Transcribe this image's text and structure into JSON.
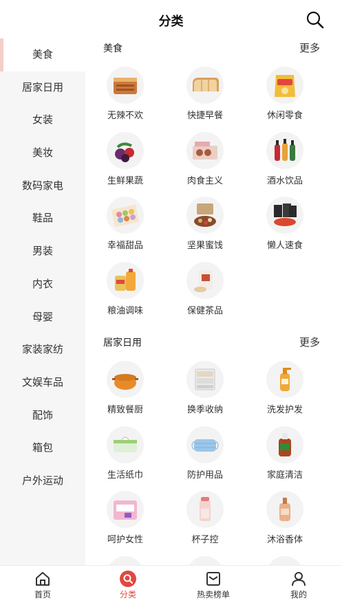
{
  "header": {
    "title": "分类"
  },
  "sidebar": {
    "items": [
      {
        "label": "美食"
      },
      {
        "label": "居家日用"
      },
      {
        "label": "女装"
      },
      {
        "label": "美妆"
      },
      {
        "label": "数码家电"
      },
      {
        "label": "鞋品"
      },
      {
        "label": "男装"
      },
      {
        "label": "内衣"
      },
      {
        "label": "母婴"
      },
      {
        "label": "家装家纺"
      },
      {
        "label": "文娱车品"
      },
      {
        "label": "配饰"
      },
      {
        "label": "箱包"
      },
      {
        "label": "户外运动"
      }
    ],
    "active_index": 0
  },
  "sections": [
    {
      "title": "美食",
      "more": "更多",
      "items": [
        {
          "label": "无辣不欢",
          "icon": "spicy-snack-icon"
        },
        {
          "label": "快捷早餐",
          "icon": "bread-icon"
        },
        {
          "label": "休闲零食",
          "icon": "chips-bag-icon"
        },
        {
          "label": "生鲜果蔬",
          "icon": "fruit-icon"
        },
        {
          "label": "肉食主义",
          "icon": "meat-box-icon"
        },
        {
          "label": "酒水饮品",
          "icon": "bottles-icon"
        },
        {
          "label": "幸福甜品",
          "icon": "macaron-icon"
        },
        {
          "label": "坚果蜜饯",
          "icon": "nuts-icon"
        },
        {
          "label": "懒人速食",
          "icon": "instant-food-icon"
        },
        {
          "label": "粮油调味",
          "icon": "oil-rice-icon"
        },
        {
          "label": "保健茶品",
          "icon": "tea-icon"
        }
      ]
    },
    {
      "title": "居家日用",
      "more": "更多",
      "items": [
        {
          "label": "精致餐厨",
          "icon": "pot-icon"
        },
        {
          "label": "换季收纳",
          "icon": "storage-drawer-icon"
        },
        {
          "label": "洗发护发",
          "icon": "shampoo-icon"
        },
        {
          "label": "生活纸巾",
          "icon": "tissue-icon"
        },
        {
          "label": "防护用品",
          "icon": "mask-icon"
        },
        {
          "label": "家庭清洁",
          "icon": "cleaner-bottle-icon"
        },
        {
          "label": "呵护女性",
          "icon": "sanitary-pad-icon"
        },
        {
          "label": "杯子控",
          "icon": "cup-icon"
        },
        {
          "label": "沐浴香体",
          "icon": "body-wash-icon"
        }
      ]
    }
  ],
  "tabbar": {
    "items": [
      {
        "label": "首页",
        "icon": "home-icon"
      },
      {
        "label": "分类",
        "icon": "category-search-icon"
      },
      {
        "label": "热卖榜单",
        "icon": "ranking-list-icon"
      },
      {
        "label": "我的",
        "icon": "user-icon"
      }
    ],
    "active_index": 1
  },
  "colors": {
    "accent": "#e2473f",
    "sidebar_bg": "#f6f6f6",
    "sidebar_active_marker": "#f4cfc9"
  }
}
